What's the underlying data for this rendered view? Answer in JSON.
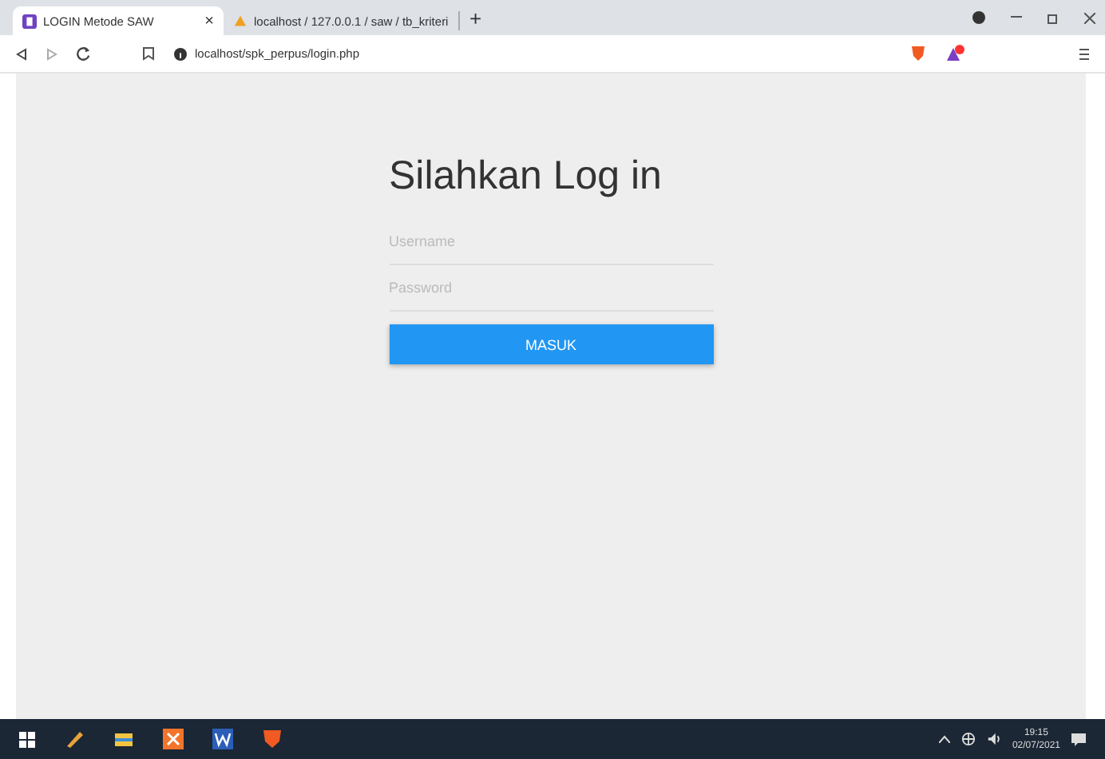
{
  "tabs": [
    {
      "title": "LOGIN Metode SAW",
      "selected": true,
      "close": "×"
    },
    {
      "title": "localhost / 127.0.0.1 / saw / tb_kriteri",
      "selected": false
    }
  ],
  "new_tab": "+",
  "address_bar": {
    "url": "localhost/spk_perpus/login.php"
  },
  "login": {
    "heading": "Silahkan Log in",
    "fields": [
      {
        "placeholder": "Username"
      },
      {
        "placeholder": "Password"
      }
    ],
    "button": "MASUK"
  },
  "taskbar": {
    "time": "19:15",
    "date": "02/07/2021"
  }
}
